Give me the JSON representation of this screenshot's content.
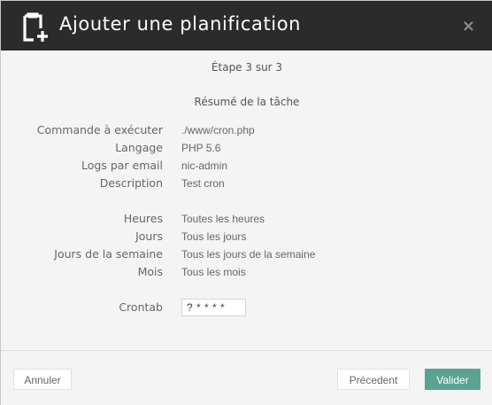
{
  "header": {
    "title": "Ajouter une planification",
    "close_symbol": "×",
    "icon": "clipboard-plus-icon"
  },
  "step": "Étape 3 sur 3",
  "summary_title": "Résumé de la tâche",
  "details": [
    {
      "label": "Commande à exécuter",
      "value": "./www/cron.php"
    },
    {
      "label": "Langage",
      "value": "PHP 5.6"
    },
    {
      "label": "Logs par email",
      "value": "nic-admin"
    },
    {
      "label": "Description",
      "value": "Test cron"
    }
  ],
  "schedule": [
    {
      "label": "Heures",
      "value": "Toutes les heures"
    },
    {
      "label": "Jours",
      "value": "Tous les jours"
    },
    {
      "label": "Jours de la semaine",
      "value": "Tous les jours de la semaine"
    },
    {
      "label": "Mois",
      "value": "Tous les mois"
    }
  ],
  "crontab": {
    "label": "Crontab",
    "value": "? * * * *"
  },
  "footer": {
    "cancel_label": "Annuler",
    "prev_label": "Précedent",
    "validate_label": "Valider"
  },
  "colors": {
    "header_bg": "#2b2b2b",
    "accent": "#5aa394",
    "body_bg": "#f4f4f4"
  }
}
